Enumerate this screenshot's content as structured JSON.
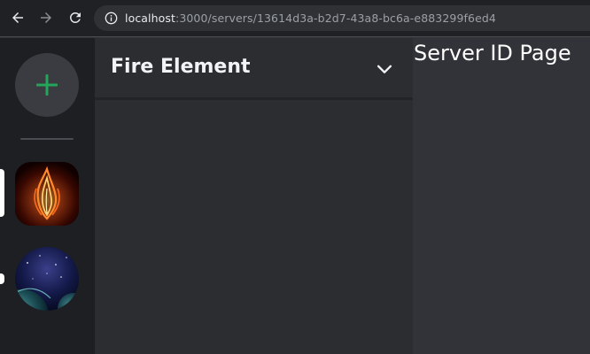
{
  "browser": {
    "url_host": "localhost",
    "url_rest": ":3000/servers/13614d3a-b2d7-43a8-bc6a-e883299f6ed4"
  },
  "icons": {
    "back": "arrow-left-icon",
    "forward": "arrow-right-icon",
    "reload": "reload-icon",
    "site_info": "info-icon",
    "add_server": "plus-icon",
    "server_menu": "chevron-down-icon"
  },
  "colors": {
    "accent_green": "#23a55a",
    "rail_bg": "#1e1f22",
    "channel_bg": "#2b2d31",
    "main_bg": "#313338"
  },
  "servers": [
    {
      "image": "fire-flame-image",
      "active": true
    },
    {
      "image": "planet-space-image",
      "active": false
    }
  ],
  "channel_panel": {
    "server_name": "Fire Element"
  },
  "main": {
    "heading": "Server ID Page"
  }
}
